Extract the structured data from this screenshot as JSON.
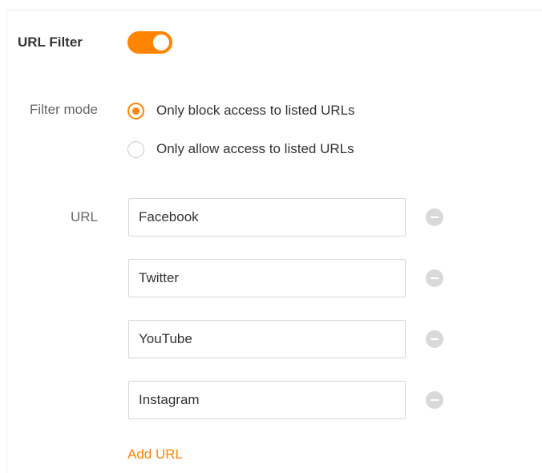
{
  "url_filter": {
    "title": "URL Filter",
    "enabled": true,
    "accent_color": "#ff8400"
  },
  "filter_mode": {
    "label": "Filter mode",
    "selected": "block",
    "options": [
      {
        "value": "block",
        "label": "Only block access to listed URLs",
        "checked": true
      },
      {
        "value": "allow",
        "label": "Only allow access to listed URLs",
        "checked": false
      }
    ]
  },
  "url_list": {
    "label": "URL",
    "entries": [
      "Facebook",
      "Twitter",
      "YouTube",
      "Instagram"
    ],
    "remove_icon": "minus-circle-icon",
    "add_label": "Add URL"
  }
}
